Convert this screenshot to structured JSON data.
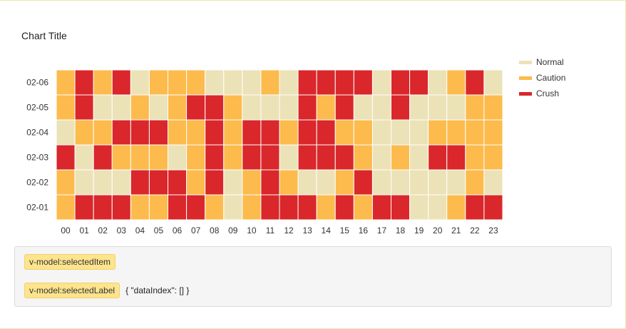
{
  "chart_data": {
    "type": "heatmap",
    "title": "Chart Title",
    "x_categories": [
      "00",
      "01",
      "02",
      "03",
      "04",
      "05",
      "06",
      "07",
      "08",
      "09",
      "10",
      "11",
      "12",
      "13",
      "14",
      "15",
      "16",
      "17",
      "18",
      "19",
      "20",
      "21",
      "22",
      "23"
    ],
    "y_categories": [
      "02-01",
      "02-02",
      "02-03",
      "02-04",
      "02-05",
      "02-06"
    ],
    "levels": [
      "Normal",
      "Caution",
      "Crush"
    ],
    "level_colors": {
      "Normal": "#ece2b7",
      "Caution": "#fcbb4c",
      "Crush": "#d9272b"
    },
    "values": {
      "02-06": [
        1,
        2,
        1,
        2,
        0,
        1,
        1,
        1,
        0,
        0,
        0,
        1,
        0,
        2,
        2,
        2,
        2,
        0,
        2,
        2,
        0,
        1,
        2,
        0
      ],
      "02-05": [
        1,
        2,
        0,
        0,
        1,
        0,
        1,
        2,
        2,
        1,
        0,
        0,
        0,
        2,
        1,
        2,
        0,
        0,
        2,
        0,
        0,
        0,
        1,
        1
      ],
      "02-04": [
        0,
        1,
        1,
        2,
        2,
        2,
        1,
        1,
        2,
        1,
        2,
        2,
        1,
        2,
        2,
        1,
        1,
        0,
        0,
        0,
        1,
        1,
        1,
        1
      ],
      "02-03": [
        2,
        0,
        2,
        1,
        1,
        1,
        0,
        1,
        2,
        1,
        2,
        2,
        0,
        2,
        2,
        2,
        1,
        0,
        1,
        0,
        2,
        2,
        1,
        1
      ],
      "02-02": [
        1,
        0,
        0,
        0,
        2,
        2,
        2,
        1,
        2,
        0,
        1,
        2,
        1,
        0,
        0,
        1,
        2,
        0,
        0,
        0,
        0,
        0,
        1,
        0
      ],
      "02-01": [
        1,
        2,
        2,
        2,
        1,
        1,
        2,
        2,
        1,
        0,
        1,
        2,
        2,
        2,
        1,
        2,
        1,
        2,
        2,
        0,
        0,
        1,
        2,
        2
      ]
    },
    "legend_position": "top-right"
  },
  "vmodel": {
    "selected_item_label": "v-model:selectedItem",
    "selected_item_value": "",
    "selected_label_label": "v-model:selectedLabel",
    "selected_label_value": "{ \"dataIndex\": [] }"
  }
}
